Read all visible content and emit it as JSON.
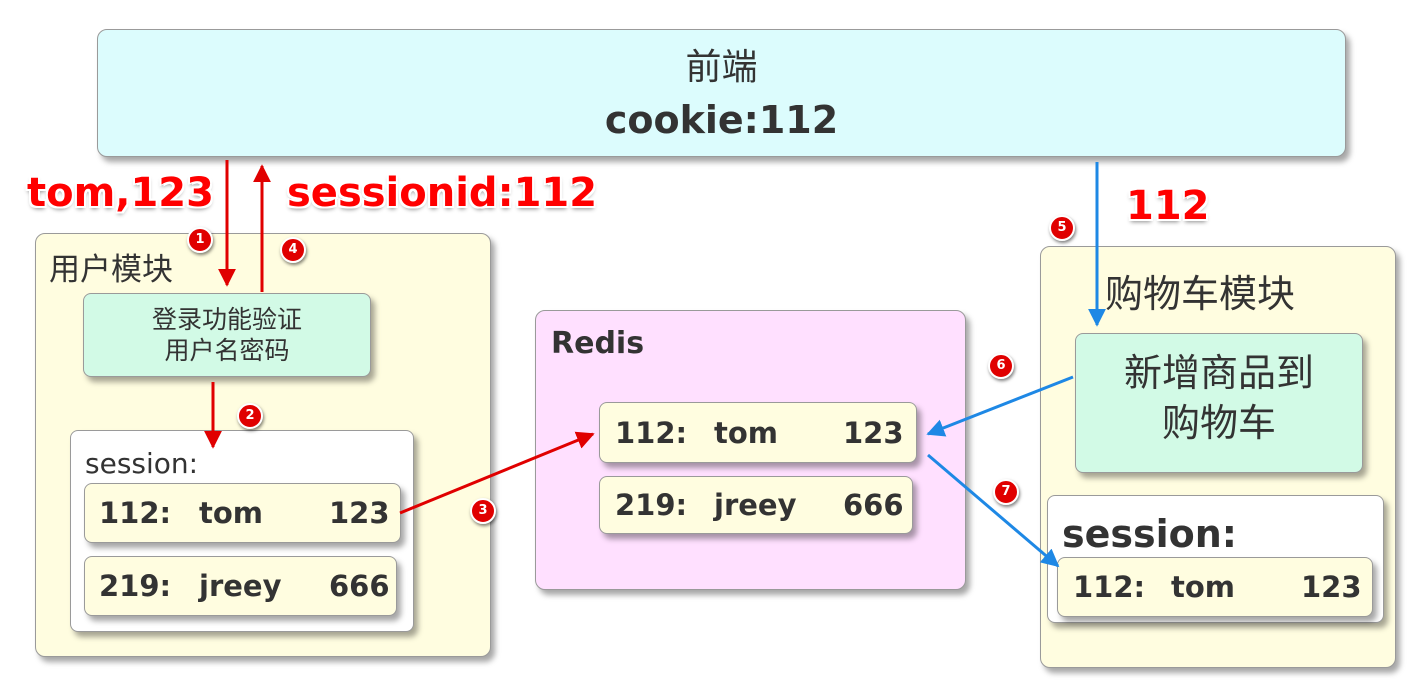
{
  "frontend": {
    "title": "前端",
    "cookie": "cookie:112"
  },
  "annotations": {
    "login_request": "tom,123",
    "session_response": "sessionid:112",
    "cart_cookie": "112"
  },
  "user_module": {
    "title": "用户模块",
    "login_line1": "登录功能验证",
    "login_line2": "用户名密码",
    "session_title": "session:",
    "rows": [
      {
        "id": "112:",
        "user": "tom",
        "pwd": "123"
      },
      {
        "id": "219:",
        "user": "jreey",
        "pwd": "666"
      }
    ]
  },
  "redis": {
    "title": "Redis",
    "rows": [
      {
        "id": "112:",
        "user": "tom",
        "pwd": "123"
      },
      {
        "id": "219:",
        "user": "jreey",
        "pwd": "666"
      }
    ]
  },
  "cart_module": {
    "title": "购物车模块",
    "add_line1": "新增商品到",
    "add_line2": "购物车",
    "session_title": "session:",
    "rows": [
      {
        "id": "112:",
        "user": "tom",
        "pwd": "123"
      }
    ]
  },
  "steps": [
    "1",
    "2",
    "3",
    "4",
    "5",
    "6",
    "7"
  ],
  "colors": {
    "red_arrow": "#e00000",
    "blue_arrow": "#1e88e5",
    "frontend_bg": "#dcfcfd",
    "module_bg": "#fffde0",
    "redis_bg": "#ffe0ff",
    "green_box": "#d2fae6",
    "badge": "#e00000"
  }
}
